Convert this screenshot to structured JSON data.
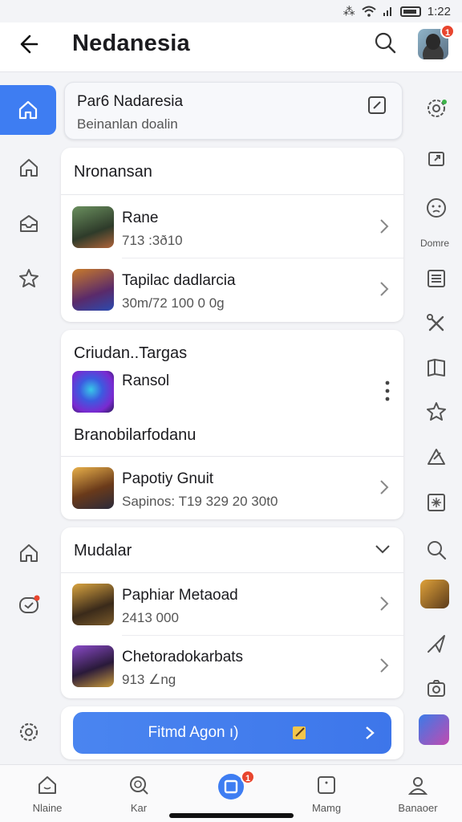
{
  "status": {
    "time": "1:22"
  },
  "header": {
    "title": "Nedanesia",
    "avatar_badge": "1"
  },
  "top_card": {
    "title": "Par6  Nadaresia",
    "subtitle": "Beinanlan doalin"
  },
  "section1": {
    "title": "Nronansan",
    "items": [
      {
        "name": "Rane",
        "sub": "713 :3ð10"
      },
      {
        "name": "Tapilac dadlarcia",
        "sub": "30m/72 100 0 0g"
      }
    ]
  },
  "section2": {
    "title": "Criudan..Targas",
    "featured": {
      "name": "Ransol"
    },
    "subheading": "Branobilarfodanu",
    "items": [
      {
        "name": "Papotiy Gnuit",
        "sub": "Sapinos: T19 329 20 30t0"
      }
    ]
  },
  "section3": {
    "title": "Mudalar",
    "items": [
      {
        "name": "Paphiar Metaoad",
        "sub": "2413 000"
      },
      {
        "name": "Chetoradokarbats",
        "sub": "913 ∠ng"
      }
    ]
  },
  "cta": {
    "label": "Fitmd Agon ı)"
  },
  "right_rail": {
    "label": "Domre"
  },
  "bottom_nav": {
    "items": [
      {
        "label": "Nlaine"
      },
      {
        "label": "Kar"
      },
      {
        "label": "",
        "badge": "1"
      },
      {
        "label": "Mamg"
      },
      {
        "label": "Banaoer"
      }
    ]
  },
  "colors": {
    "accent": "#3e7df2",
    "badge": "#e8452e"
  }
}
